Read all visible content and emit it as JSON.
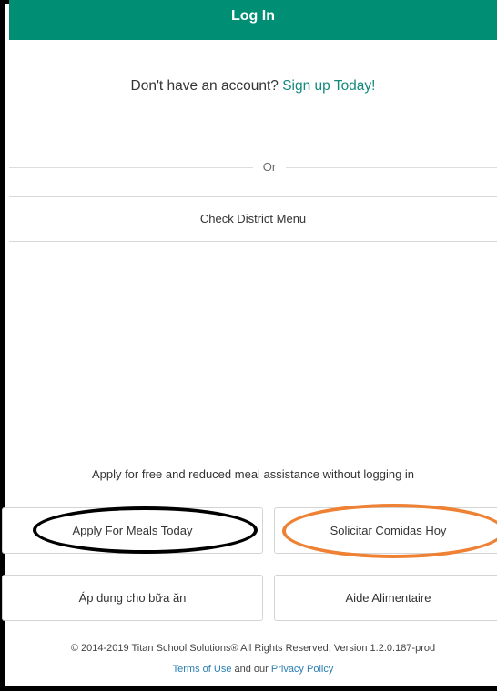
{
  "header": {
    "title": "Log In",
    "background_color": "#008f75"
  },
  "signup": {
    "prompt": "Don't have an account?",
    "link_label": "Sign up Today!",
    "link_color": "#13897c"
  },
  "divider": {
    "label": "Or"
  },
  "district_menu": {
    "label": "Check District Menu"
  },
  "apply": {
    "description": "Apply for free and reduced meal assistance without logging in",
    "buttons": [
      {
        "label": "Apply For Meals Today"
      },
      {
        "label": "Solicitar Comidas Hoy"
      },
      {
        "label": "Áp dụng cho bữa ăn"
      },
      {
        "label": "Aide Alimentaire"
      }
    ]
  },
  "annotations": {
    "circle_colors": [
      "#000000",
      "#ee8133"
    ]
  },
  "footer": {
    "copyright": "© 2014-2019 Titan School Solutions® All Rights Reserved, Version 1.2.0.187-prod",
    "terms_label": "Terms of Use",
    "and_text": "and our",
    "privacy_label": "Privacy Policy"
  }
}
